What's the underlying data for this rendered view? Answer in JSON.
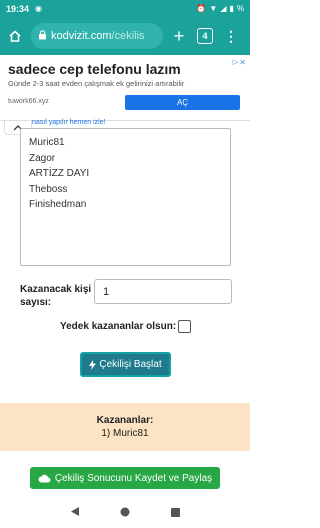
{
  "status": {
    "time": "19:34",
    "battery": "%"
  },
  "browser": {
    "url_host": "kodvizit.com",
    "url_path": "/cekilis",
    "tab_count": "4"
  },
  "ad": {
    "title": "sadece cep telefonu lazım",
    "subtitle": "Günde 2-3 saat evden çalışmak ek gelirinizi artırabilir",
    "domain": "tuwork66.xyz",
    "cta": "AÇ"
  },
  "howto_link": "nasıl yapılır hemen izle!",
  "names": [
    "Muric81",
    "Zagor",
    "ARTİZZ DAYI",
    "Theboss",
    "Finishedman"
  ],
  "form": {
    "count_label": "Kazanacak kişi sayısı:",
    "count_value": "1",
    "backup_label": "Yedek kazananlar olsun:",
    "start_button": "Çekilişi Başlat"
  },
  "winners": {
    "title": "Kazananlar:",
    "items": [
      "1) Muric81"
    ]
  },
  "save_button": "Çekiliş Sonucunu Kaydet ve Paylaş"
}
